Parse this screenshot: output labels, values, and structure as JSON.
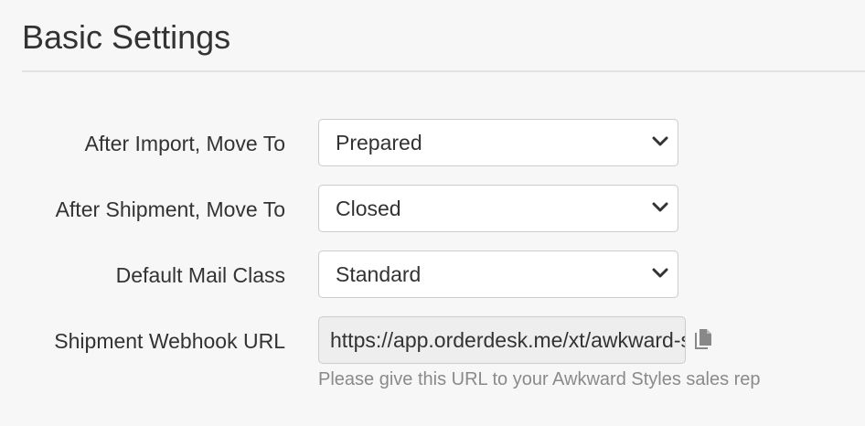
{
  "section": {
    "title": "Basic Settings"
  },
  "settings": [
    {
      "label": "After Import, Move To",
      "value": "Prepared"
    },
    {
      "label": "After Shipment, Move To",
      "value": "Closed"
    },
    {
      "label": "Default Mail Class",
      "value": "Standard"
    }
  ],
  "webhook": {
    "label": "Shipment Webhook URL",
    "value": "https://app.orderdesk.me/xt/awkward-styles",
    "help": "Please give this URL to your Awkward Styles sales rep",
    "copy_icon": "copy-icon"
  },
  "icons": {
    "select_arrow": "chevron-down-icon"
  },
  "colors": {
    "background": "#f7f7f7",
    "text": "#333333",
    "help_text": "#8a8a8a",
    "readonly_field": "#eeeeee",
    "border": "#cccccc"
  }
}
